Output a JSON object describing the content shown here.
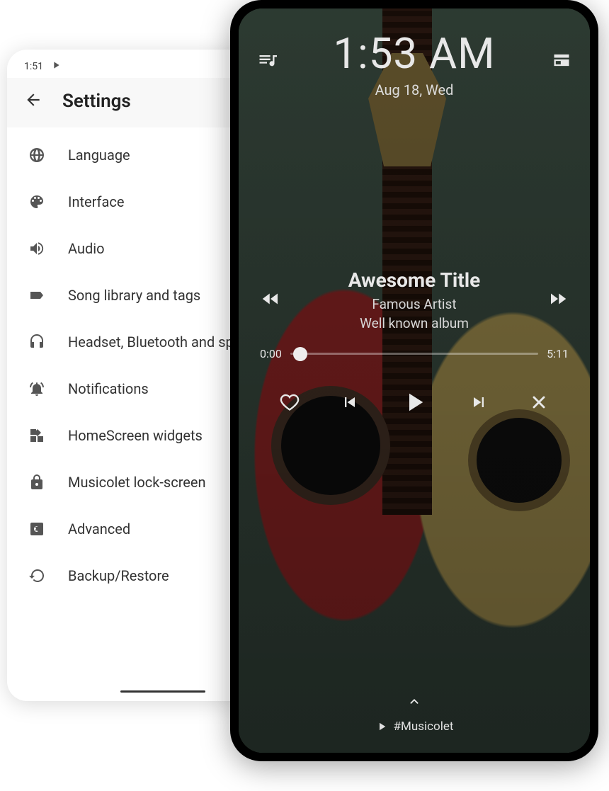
{
  "settings": {
    "status_time": "1:51",
    "title": "Settings",
    "items": [
      {
        "icon": "globe",
        "label": "Language"
      },
      {
        "icon": "palette",
        "label": "Interface"
      },
      {
        "icon": "volume",
        "label": "Audio"
      },
      {
        "icon": "tag",
        "label": "Song library and tags"
      },
      {
        "icon": "headset",
        "label": "Headset, Bluetooth and speakers"
      },
      {
        "icon": "bell",
        "label": "Notifications"
      },
      {
        "icon": "widgets",
        "label": "HomeScreen widgets"
      },
      {
        "icon": "lock",
        "label": "Musicolet lock-screen"
      },
      {
        "icon": "gear",
        "label": "Advanced"
      },
      {
        "icon": "restore",
        "label": "Backup/Restore"
      }
    ]
  },
  "lockscreen": {
    "time": "1:53 AM",
    "date": "Aug 18, Wed",
    "song": {
      "title": "Awesome Title",
      "artist": "Famous Artist",
      "album": "Well known album"
    },
    "progress": {
      "elapsed": "0:00",
      "total": "5:11",
      "percent": 4
    },
    "brand": "#Musicolet"
  },
  "colors": {
    "text_dark": "#333333",
    "icon_grey": "#555555",
    "lock_text": "#e8e8e8"
  }
}
